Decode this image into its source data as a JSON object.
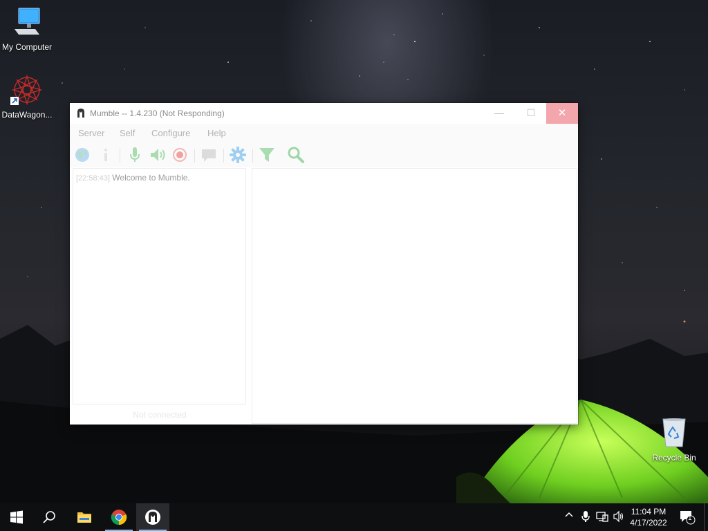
{
  "desktop": {
    "icons": [
      {
        "label": "My Computer"
      },
      {
        "label": "DataWagon..."
      },
      {
        "label": "Recycle Bin"
      }
    ]
  },
  "window": {
    "title": "Mumble -- 1.4.230 (Not Responding)",
    "controls": {
      "minimize": "—",
      "maximize": "☐",
      "close": "✕"
    },
    "menu": [
      "Server",
      "Self",
      "Configure",
      "Help"
    ],
    "toolbar_icons": [
      "globe-icon",
      "info-icon",
      "microphone-icon",
      "speaker-icon",
      "record-icon",
      "chat-icon",
      "gear-icon",
      "filter-icon",
      "search-icon"
    ],
    "log": {
      "timestamp": "[22:58:43]",
      "message": "Welcome to Mumble."
    },
    "status": "Not connected"
  },
  "taskbar": {
    "clock_time": "11:04 PM",
    "clock_date": "4/17/2022",
    "notification_count": "1"
  },
  "colors": {
    "taskbar_bg": "#0e0f11",
    "close_hover": "#f4a6ad",
    "taskbar_accent": "#76b9ed"
  }
}
